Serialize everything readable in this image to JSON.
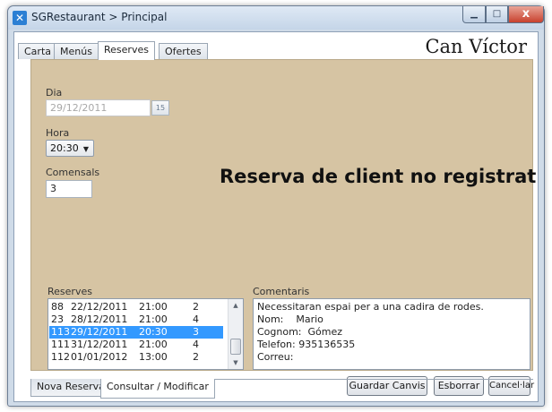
{
  "window": {
    "title": "SGRestaurant > Principal",
    "close_glyph": "x"
  },
  "brand": "Can Víctor",
  "top_tabs": [
    "Carta",
    "Menús",
    "Reserves",
    "Ofertes"
  ],
  "top_tabs_active": 2,
  "form": {
    "dia_label": "Dia",
    "dia_value": "29/12/2011",
    "calendar_label": "15",
    "hora_label": "Hora",
    "hora_value": "20:30",
    "comensals_label": "Comensals",
    "comensals_value": "3"
  },
  "heading": "Reserva de client no registrat",
  "reserves": {
    "label": "Reserves",
    "rows": [
      {
        "id": "88",
        "date": "22/12/2011",
        "time": "21:00",
        "guests": "2",
        "selected": false
      },
      {
        "id": "23",
        "date": "28/12/2011",
        "time": "21:00",
        "guests": "4",
        "selected": false
      },
      {
        "id": "113",
        "date": "29/12/2011",
        "time": "20:30",
        "guests": "3",
        "selected": true
      },
      {
        "id": "111",
        "date": "31/12/2011",
        "time": "21:00",
        "guests": "4",
        "selected": false
      },
      {
        "id": "112",
        "date": "01/01/2012",
        "time": "13:00",
        "guests": "2",
        "selected": false
      }
    ]
  },
  "comentaris": {
    "label": "Comentaris",
    "lines": [
      "Necessitaran espai per a una cadira de rodes.",
      "Nom:    Mario",
      "Cognom:  Gómez",
      "Telefon: 935136535",
      "Correu:"
    ]
  },
  "buttons": {
    "save": "Guardar Canvis",
    "delete": "Esborrar",
    "cancel": "Cancel·lar"
  },
  "bottom_tabs": [
    "Nova Reserva",
    "Consultar / Modificar"
  ],
  "bottom_tabs_active": 1,
  "colors": {
    "panel": "#d6c4a3",
    "selection": "#3399ff",
    "close": "#c8412e"
  }
}
